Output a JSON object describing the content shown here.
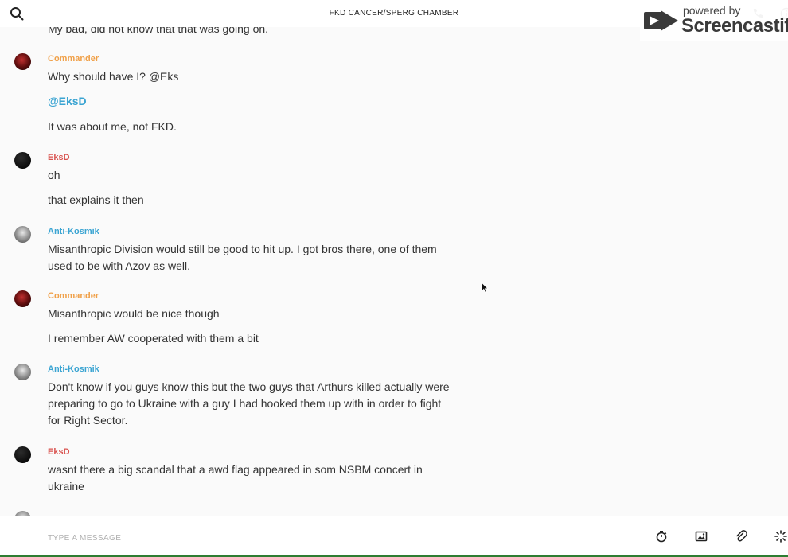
{
  "header": {
    "title": "FKD CANCER/SPERG CHAMBER"
  },
  "watermark": {
    "small": "powered by",
    "big": "Screencastify"
  },
  "messages": {
    "partial_top": "My bad, did not know that that was going on.",
    "groups": [
      {
        "author": "Commander",
        "lines": [
          "Why should have I? @Eks",
          "@EksD",
          "It was about me, not FKD."
        ]
      },
      {
        "author": "EksD",
        "lines": [
          "oh",
          "that explains it then"
        ]
      },
      {
        "author": "Anti-Kosmik",
        "lines": [
          "Misanthropic Division would still be good to hit up. I got bros there, one of them used to be with Azov as well."
        ]
      },
      {
        "author": "Commander",
        "lines": [
          "Misanthropic would be nice though",
          "I remember AW cooperated with them a bit"
        ]
      },
      {
        "author": "Anti-Kosmik",
        "lines": [
          "Don't know if you guys know this but the two guys that Arthurs killed actually were preparing to go to Ukraine with a guy I had hooked them up with in order to fight for Right Sector."
        ]
      },
      {
        "author": "EksD",
        "lines": [
          "wasnt there a big scandal that a awd flag appeared in som NSBM concert in ukraine"
        ]
      }
    ]
  },
  "composer": {
    "placeholder": "TYPE A MESSAGE",
    "tools": [
      "timer-icon",
      "image-icon",
      "paperclip-icon",
      "loading-icon"
    ]
  },
  "colors": {
    "commander": "#f0a048",
    "eksd": "#d9534f",
    "anti_kosmik": "#3aa4d2",
    "mention": "#3aa4d2"
  }
}
